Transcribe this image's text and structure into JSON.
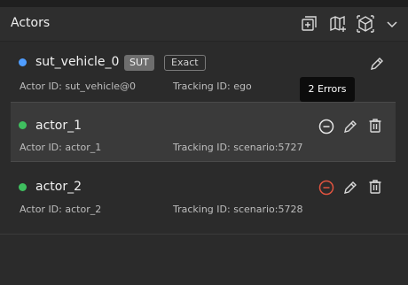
{
  "panel": {
    "title": "Actors",
    "header_icons": [
      "add-actor-icon",
      "map-add-icon",
      "cube-view-icon",
      "chevron-down-icon"
    ]
  },
  "tooltip": {
    "text": "2 Errors"
  },
  "actors": [
    {
      "name": "sut_vehicle_0",
      "dot_color": "#4f9dff",
      "badges": [
        "SUT",
        "Exact"
      ],
      "actor_id_label": "Actor ID: sut_vehicle@0",
      "tracking_id_label": "Tracking ID: ego"
    },
    {
      "name": "actor_1",
      "dot_color": "#3fbf5f",
      "actor_id_label": "Actor ID: actor_1",
      "tracking_id_label": "Tracking ID: scenario:5727"
    },
    {
      "name": "actor_2",
      "dot_color": "#3fbf5f",
      "actor_id_label": "Actor ID: actor_2",
      "tracking_id_label": "Tracking ID: scenario:5728"
    }
  ],
  "colors": {
    "error": "#e0533f",
    "icon": "#d8d8d8"
  }
}
